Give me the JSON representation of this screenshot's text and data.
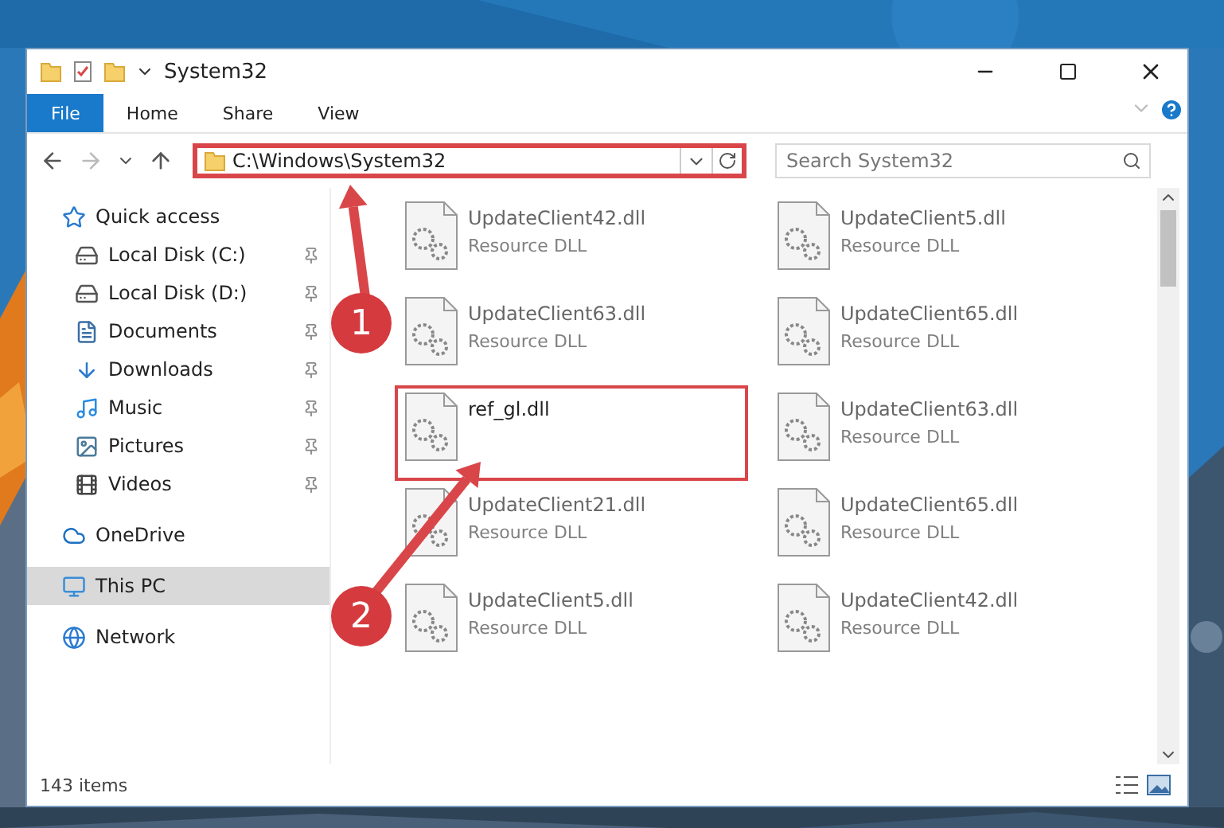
{
  "window": {
    "title": "System32"
  },
  "ribbon_tabs": [
    {
      "label": "File",
      "selected": true
    },
    {
      "label": "Home",
      "selected": false
    },
    {
      "label": "Share",
      "selected": false
    },
    {
      "label": "View",
      "selected": false
    }
  ],
  "address_bar": {
    "path": "C:\\Windows\\System32",
    "highlighted": true
  },
  "search": {
    "placeholder": "Search System32"
  },
  "sidebar": {
    "items": [
      {
        "label": "Quick access",
        "pinned": false,
        "selected": false,
        "children": [
          {
            "label": "Local Disk (C:)",
            "pinned": true,
            "selected": false
          },
          {
            "label": "Local Disk (D:)",
            "pinned": true,
            "selected": false
          },
          {
            "label": "Documents",
            "pinned": true,
            "selected": false
          },
          {
            "label": "Downloads",
            "pinned": true,
            "selected": false
          },
          {
            "label": "Music",
            "pinned": true,
            "selected": false
          },
          {
            "label": "Pictures",
            "pinned": true,
            "selected": false
          },
          {
            "label": "Videos",
            "pinned": true,
            "selected": false
          }
        ]
      },
      {
        "label": "OneDrive",
        "pinned": false,
        "selected": false
      },
      {
        "label": "This PC",
        "pinned": false,
        "selected": true
      },
      {
        "label": "Network",
        "pinned": false,
        "selected": false
      }
    ]
  },
  "files": [
    {
      "name": "UpdateClient42.dll",
      "type": "Resource DLL",
      "highlighted": false
    },
    {
      "name": "UpdateClient5.dll",
      "type": "Resource DLL",
      "highlighted": false
    },
    {
      "name": "UpdateClient63.dll",
      "type": "Resource DLL",
      "highlighted": false
    },
    {
      "name": "UpdateClient65.dll",
      "type": "Resource DLL",
      "highlighted": false
    },
    {
      "name": "ref_gl.dll",
      "highlighted": true
    },
    {
      "name": "UpdateClient63.dll",
      "type": "Resource DLL",
      "highlighted": false
    },
    {
      "name": "UpdateClient21.dll",
      "type": "Resource DLL",
      "highlighted": false
    },
    {
      "name": "UpdateClient65.dll",
      "type": "Resource DLL",
      "highlighted": false
    },
    {
      "name": "UpdateClient5.dll",
      "type": "Resource DLL",
      "highlighted": false
    },
    {
      "name": "UpdateClient42.dll",
      "type": "Resource DLL",
      "highlighted": false
    }
  ],
  "status_bar": {
    "item_count": "143 items"
  },
  "callouts": [
    {
      "number": "1"
    },
    {
      "number": "2"
    }
  ]
}
